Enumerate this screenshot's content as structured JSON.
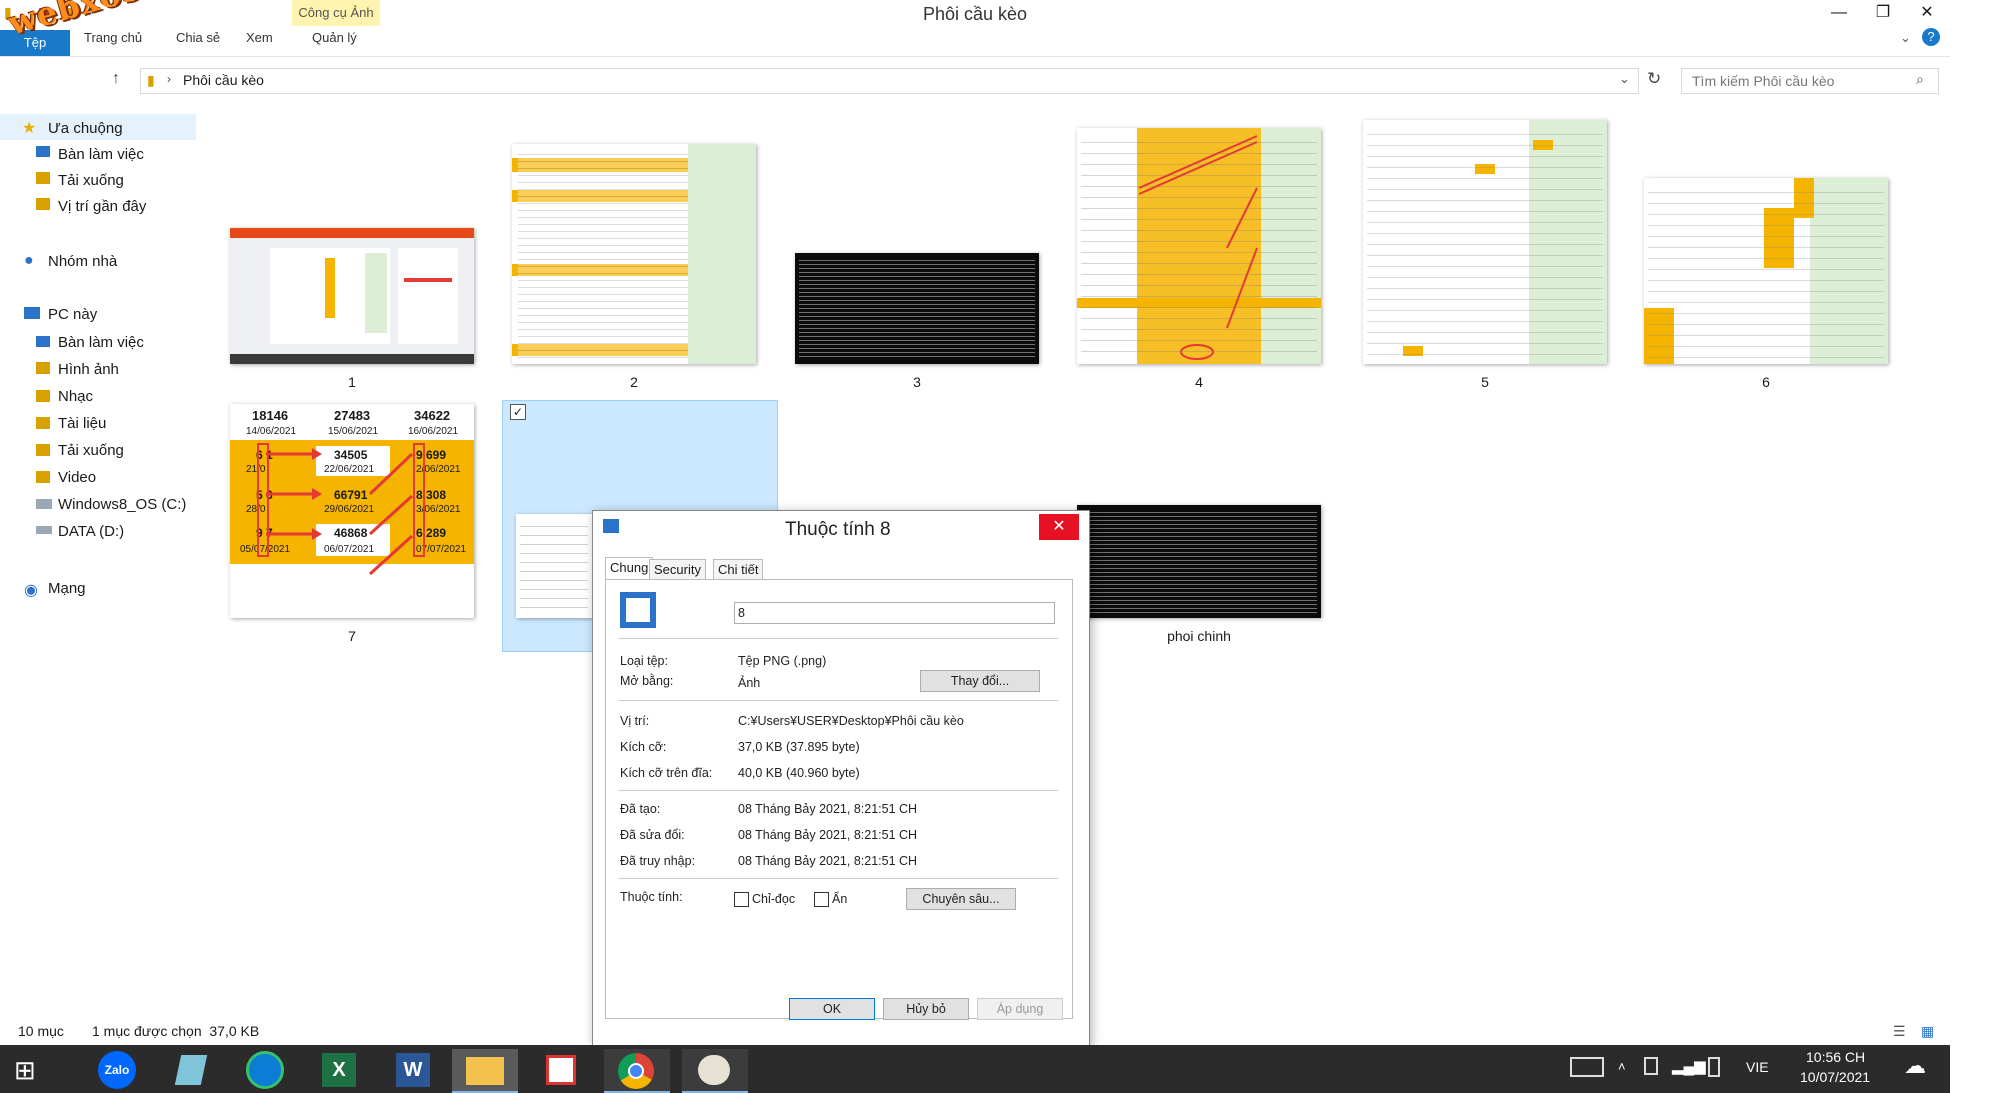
{
  "window": {
    "title": "Phôi cầu kèo",
    "contextual_tab_group": "Công cụ Ảnh"
  },
  "ribbon": {
    "tabs": [
      "Tệp",
      "Trang chủ",
      "Chia sẻ",
      "Xem",
      "Quản lý"
    ]
  },
  "address": {
    "path": "Phôi cầu kèo",
    "search_placeholder": "Tìm kiếm Phôi cầu kèo"
  },
  "navigation": {
    "favorites_label": "Ưa chuộng",
    "favorites": [
      "Bàn làm việc",
      "Tải xuống",
      "Vị trí gần đây"
    ],
    "homegroup": "Nhóm nhà",
    "this_pc_label": "PC này",
    "this_pc": [
      "Bàn làm việc",
      "Hình ảnh",
      "Nhạc",
      "Tài liệu",
      "Tải xuống",
      "Video",
      "Windows8_OS (C:)",
      "DATA (D:)"
    ],
    "network": "Mạng"
  },
  "files": [
    {
      "label": "1"
    },
    {
      "label": "2"
    },
    {
      "label": "3"
    },
    {
      "label": "4"
    },
    {
      "label": "5"
    },
    {
      "label": "6"
    },
    {
      "label": "7"
    },
    {
      "label": "8"
    },
    {
      "label": "phoi chinh"
    }
  ],
  "thumb7": {
    "top_nums": [
      "18146",
      "27483",
      "34622"
    ],
    "top_dates": [
      "14/06/2021",
      "15/06/2021",
      "16/06/2021"
    ],
    "rows": [
      {
        "a": "6 1",
        "a_date": "21/0",
        "mid": "34505",
        "mid_date": "22/06/2021",
        "c": "9 699",
        "c_date": "2/06/2021"
      },
      {
        "a": "5 6",
        "a_date": "28/0",
        "mid": "66791",
        "mid_date": "29/06/2021",
        "c": "8 308",
        "c_date": "3/06/2021"
      },
      {
        "a": "9 7",
        "a_date": "05/07/2021",
        "mid": "46868",
        "mid_date": "06/07/2021",
        "c": "6 289",
        "c_date": "07/07/2021"
      }
    ]
  },
  "dialog": {
    "title": "Thuộc tính 8",
    "tabs": [
      "Chung",
      "Security",
      "Chi tiết"
    ],
    "filename": "8",
    "rows": [
      {
        "label": "Loại tệp:",
        "value": "Tệp PNG (.png)"
      },
      {
        "label": "Mở bằng:",
        "value": "Ảnh"
      },
      {
        "label": "Vị trí:",
        "value": "C:¥Users¥USER¥Desktop¥Phôi cầu kèo"
      },
      {
        "label": "Kích cỡ:",
        "value": "37,0 KB (37.895 byte)"
      },
      {
        "label": "Kích cỡ trên đĩa:",
        "value": "40,0 KB (40.960 byte)"
      },
      {
        "label": "Đã tạo:",
        "value": "08 Tháng Bảy 2021, 8:21:51 CH"
      },
      {
        "label": "Đã sửa đổi:",
        "value": "08 Tháng Bảy 2021, 8:21:51 CH"
      },
      {
        "label": "Đã truy nhập:",
        "value": "08 Tháng Bảy 2021, 8:21:51 CH"
      }
    ],
    "change_button": "Thay đổi...",
    "attributes_label": "Thuộc tính:",
    "readonly_label": "Chỉ-đọc",
    "hidden_label": "Ẩn",
    "advanced_button": "Chuyên sâu...",
    "ok": "OK",
    "cancel": "Hủy bỏ",
    "apply": "Áp dụng"
  },
  "status": {
    "count": "10 mục",
    "selection": "1 mục được chọn  37,0 KB"
  },
  "taskbar": {
    "apps": [
      "Zalo",
      "Notepad",
      "Edge",
      "Excel",
      "Word",
      "File Explorer",
      "Snipping",
      "Chrome",
      "Paint"
    ],
    "lang": "VIE",
    "time": "10:56 CH",
    "date": "10/07/2021"
  },
  "watermark": "webxoso.net",
  "colors": {
    "accent": "#1979ca",
    "orange": "#f5b400",
    "green_col": "#dcefd6",
    "close_red": "#e81123",
    "taskbar": "#2b2b2b"
  }
}
